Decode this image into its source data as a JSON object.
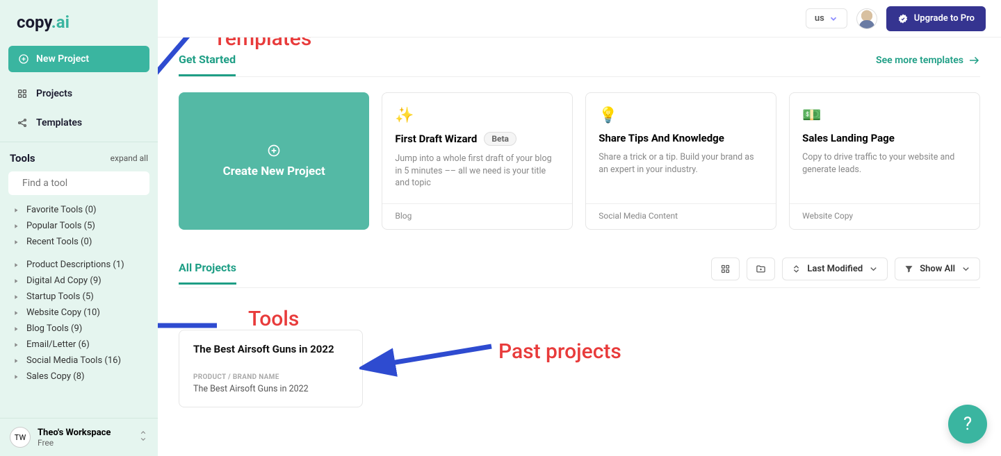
{
  "logo": {
    "text_1": "copy",
    "text_2": ".ai"
  },
  "sidebar": {
    "new_project": "New Project",
    "nav": {
      "projects": "Projects",
      "templates": "Templates"
    },
    "tools_title": "Tools",
    "expand_all": "expand all",
    "search_placeholder": "Find a tool",
    "tool_groups_a": [
      "Favorite Tools (0)",
      "Popular Tools (5)",
      "Recent Tools (0)"
    ],
    "tool_groups_b": [
      "Product Descriptions (1)",
      "Digital Ad Copy (9)",
      "Startup Tools (5)",
      "Website Copy (10)",
      "Blog Tools (9)",
      "Email/Letter (6)",
      "Social Media Tools (16)",
      "Sales Copy (8)"
    ],
    "workspace": {
      "initials": "TW",
      "name": "Theo's Workspace",
      "plan": "Free"
    }
  },
  "topbar": {
    "locale": "us",
    "upgrade": "Upgrade to Pro"
  },
  "get_started": {
    "tab": "Get Started",
    "see_more": "See more templates",
    "create_label": "Create New Project",
    "templates": [
      {
        "title": "First Draft Wizard",
        "badge": "Beta",
        "desc": "Jump into a whole first draft of your blog in 5 minutes –– all we need is your title and topic",
        "category": "Blog",
        "icon": "✨"
      },
      {
        "title": "Share Tips And Knowledge",
        "badge": "",
        "desc": "Share a trick or a tip. Build your brand as an expert in your industry.",
        "category": "Social Media Content",
        "icon": "💡"
      },
      {
        "title": "Sales Landing Page",
        "badge": "",
        "desc": "Copy to drive traffic to your website and generate leads.",
        "category": "Website Copy",
        "icon": "💵"
      }
    ]
  },
  "all_projects": {
    "tab": "All Projects",
    "sort_label": "Last Modified",
    "filter_label": "Show All",
    "project": {
      "title": "The Best Airsoft Guns in 2022",
      "field_label": "PRODUCT / BRAND NAME",
      "field_value": "The Best Airsoft Guns in 2022"
    }
  },
  "annotations": {
    "templates": "Templates",
    "tools": "Tools",
    "past_projects": "Past projects"
  },
  "help": "?"
}
